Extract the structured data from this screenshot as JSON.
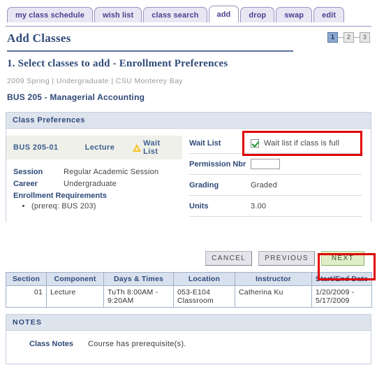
{
  "tabs": [
    {
      "label": "my class schedule",
      "active": false
    },
    {
      "label": "wish list",
      "active": false
    },
    {
      "label": "class search",
      "active": false
    },
    {
      "label": "add",
      "active": true
    },
    {
      "label": "drop",
      "active": false
    },
    {
      "label": "swap",
      "active": false
    },
    {
      "label": "edit",
      "active": false
    }
  ],
  "page": {
    "title": "Add Classes",
    "section_heading": "1.  Select classes to add - Enrollment Preferences",
    "breadcrumb": "2009 Spring | Undergraduate | CSU Monterey Bay",
    "course_title": "BUS  205 - Managerial Accounting"
  },
  "steps": [
    {
      "label": "1",
      "active": true
    },
    {
      "label": "2",
      "active": false
    },
    {
      "label": "3",
      "active": false
    }
  ],
  "preferences": {
    "panel_title": "Class Preferences",
    "class_row": {
      "code": "BUS 205-01",
      "component": "Lecture",
      "status": "Wait List",
      "status_icon": "warning-triangle-icon"
    },
    "details": [
      {
        "label": "Session",
        "value": "Regular Academic Session"
      },
      {
        "label": "Career",
        "value": "Undergraduate"
      }
    ],
    "requirements_heading": "Enrollment Requirements",
    "requirements": [
      "(prereq: BUS 203)"
    ],
    "fields": [
      {
        "label": "Wait List",
        "type": "checkbox",
        "checked": true,
        "checkbox_label": "Wait list if class is full"
      },
      {
        "label": "Permission Nbr",
        "type": "input",
        "value": "",
        "placeholder": ""
      },
      {
        "label": "Grading",
        "type": "text",
        "value": "Graded"
      },
      {
        "label": "Units",
        "type": "text",
        "value": "3.00"
      }
    ]
  },
  "buttons": {
    "cancel": "CANCEL",
    "previous": "PREVIOUS",
    "next": "NEXT"
  },
  "schedule_table": {
    "headers": [
      "Section",
      "Component",
      "Days & Times",
      "Location",
      "Instructor",
      "Start/End Date"
    ],
    "rows": [
      {
        "section": "01",
        "component": "Lecture",
        "days_times": "TuTh 8:00AM - 9:20AM",
        "location": "053-E104 Classroom",
        "instructor": "Catherina Ku",
        "start_end_date": "1/20/2009 - 5/17/2009"
      }
    ]
  },
  "notes": {
    "panel_title": "NOTES",
    "label": "Class Notes",
    "text": "Course has prerequisite(s)."
  },
  "colors": {
    "accent_blue": "#2e4978",
    "tab_purple": "#4d3f8f",
    "highlight_red": "#e00000",
    "warning_amber": "#f5bf27",
    "check_green": "#159b2e",
    "next_button_green": "#dfeec7"
  }
}
